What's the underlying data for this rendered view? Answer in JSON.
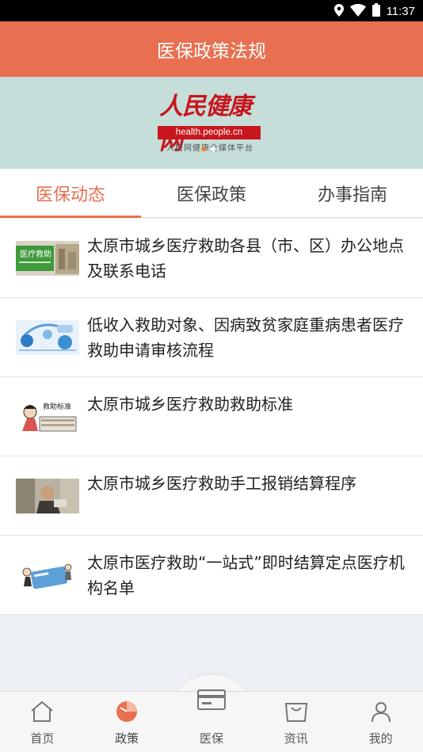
{
  "status_bar": {
    "time": "11:37"
  },
  "header": {
    "title": "医保政策法规"
  },
  "banner": {
    "logo_script": "人民健康网",
    "logo_url": "health.people.cn",
    "logo_sub": "人民网健康全媒体平台"
  },
  "tabs": [
    {
      "label": "医保动态",
      "active": true
    },
    {
      "label": "医保政策",
      "active": false
    },
    {
      "label": "办事指南",
      "active": false
    }
  ],
  "articles": [
    {
      "title": "太原市城乡医疗救助各县（市、区）办公地点及联系电话",
      "thumb_text": "医疗救助"
    },
    {
      "title": "低收入救助对象、因病致贫家庭重病患者医疗救助申请审核流程"
    },
    {
      "title": "太原市城乡医疗救助救助标准",
      "thumb_text": "救助标准"
    },
    {
      "title": "太原市城乡医疗救助手工报销结算程序"
    },
    {
      "title": "太原市医疗救助“一站式”即时结算定点医疗机构名单"
    }
  ],
  "bottom_nav": [
    {
      "label": "首页",
      "icon": "home-icon"
    },
    {
      "label": "政策",
      "icon": "policy-icon",
      "active": true
    },
    {
      "label": "医保",
      "icon": "card-icon"
    },
    {
      "label": "资讯",
      "icon": "news-icon"
    },
    {
      "label": "我的",
      "icon": "profile-icon"
    }
  ],
  "colors": {
    "accent": "#e86f50",
    "banner_bg": "#c5deda",
    "logo_red": "#c8161d"
  }
}
